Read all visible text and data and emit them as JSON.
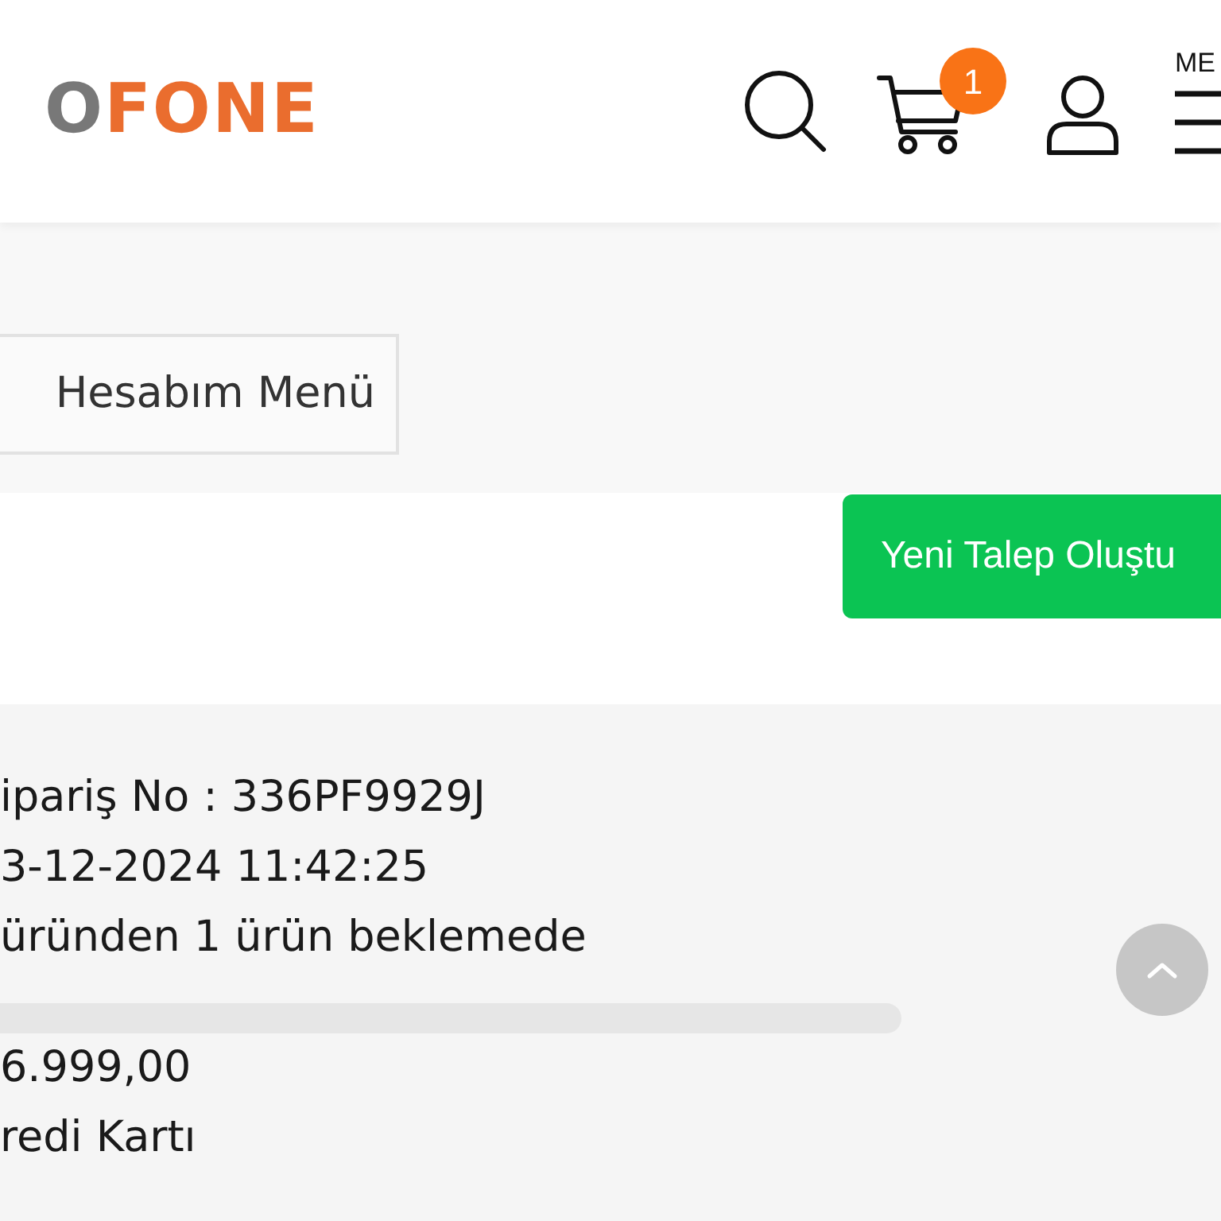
{
  "header": {
    "logo": [
      {
        "text": "O",
        "color": "#787878"
      },
      {
        "text": "FONE",
        "color": "#ea6d2e"
      }
    ],
    "cart_badge": "1",
    "menu_label": "ME"
  },
  "account_menu_button": {
    "label": "Hesabım Menü"
  },
  "new_request_button": {
    "label": "Yeni Talep Oluştu"
  },
  "order": {
    "order_no": "ipariş No : 336PF9929J",
    "date": "3-12-2024 11:42:25",
    "status": "üründen 1 ürün beklemede",
    "total": "6.999,00",
    "payment": "redi Kartı"
  }
}
